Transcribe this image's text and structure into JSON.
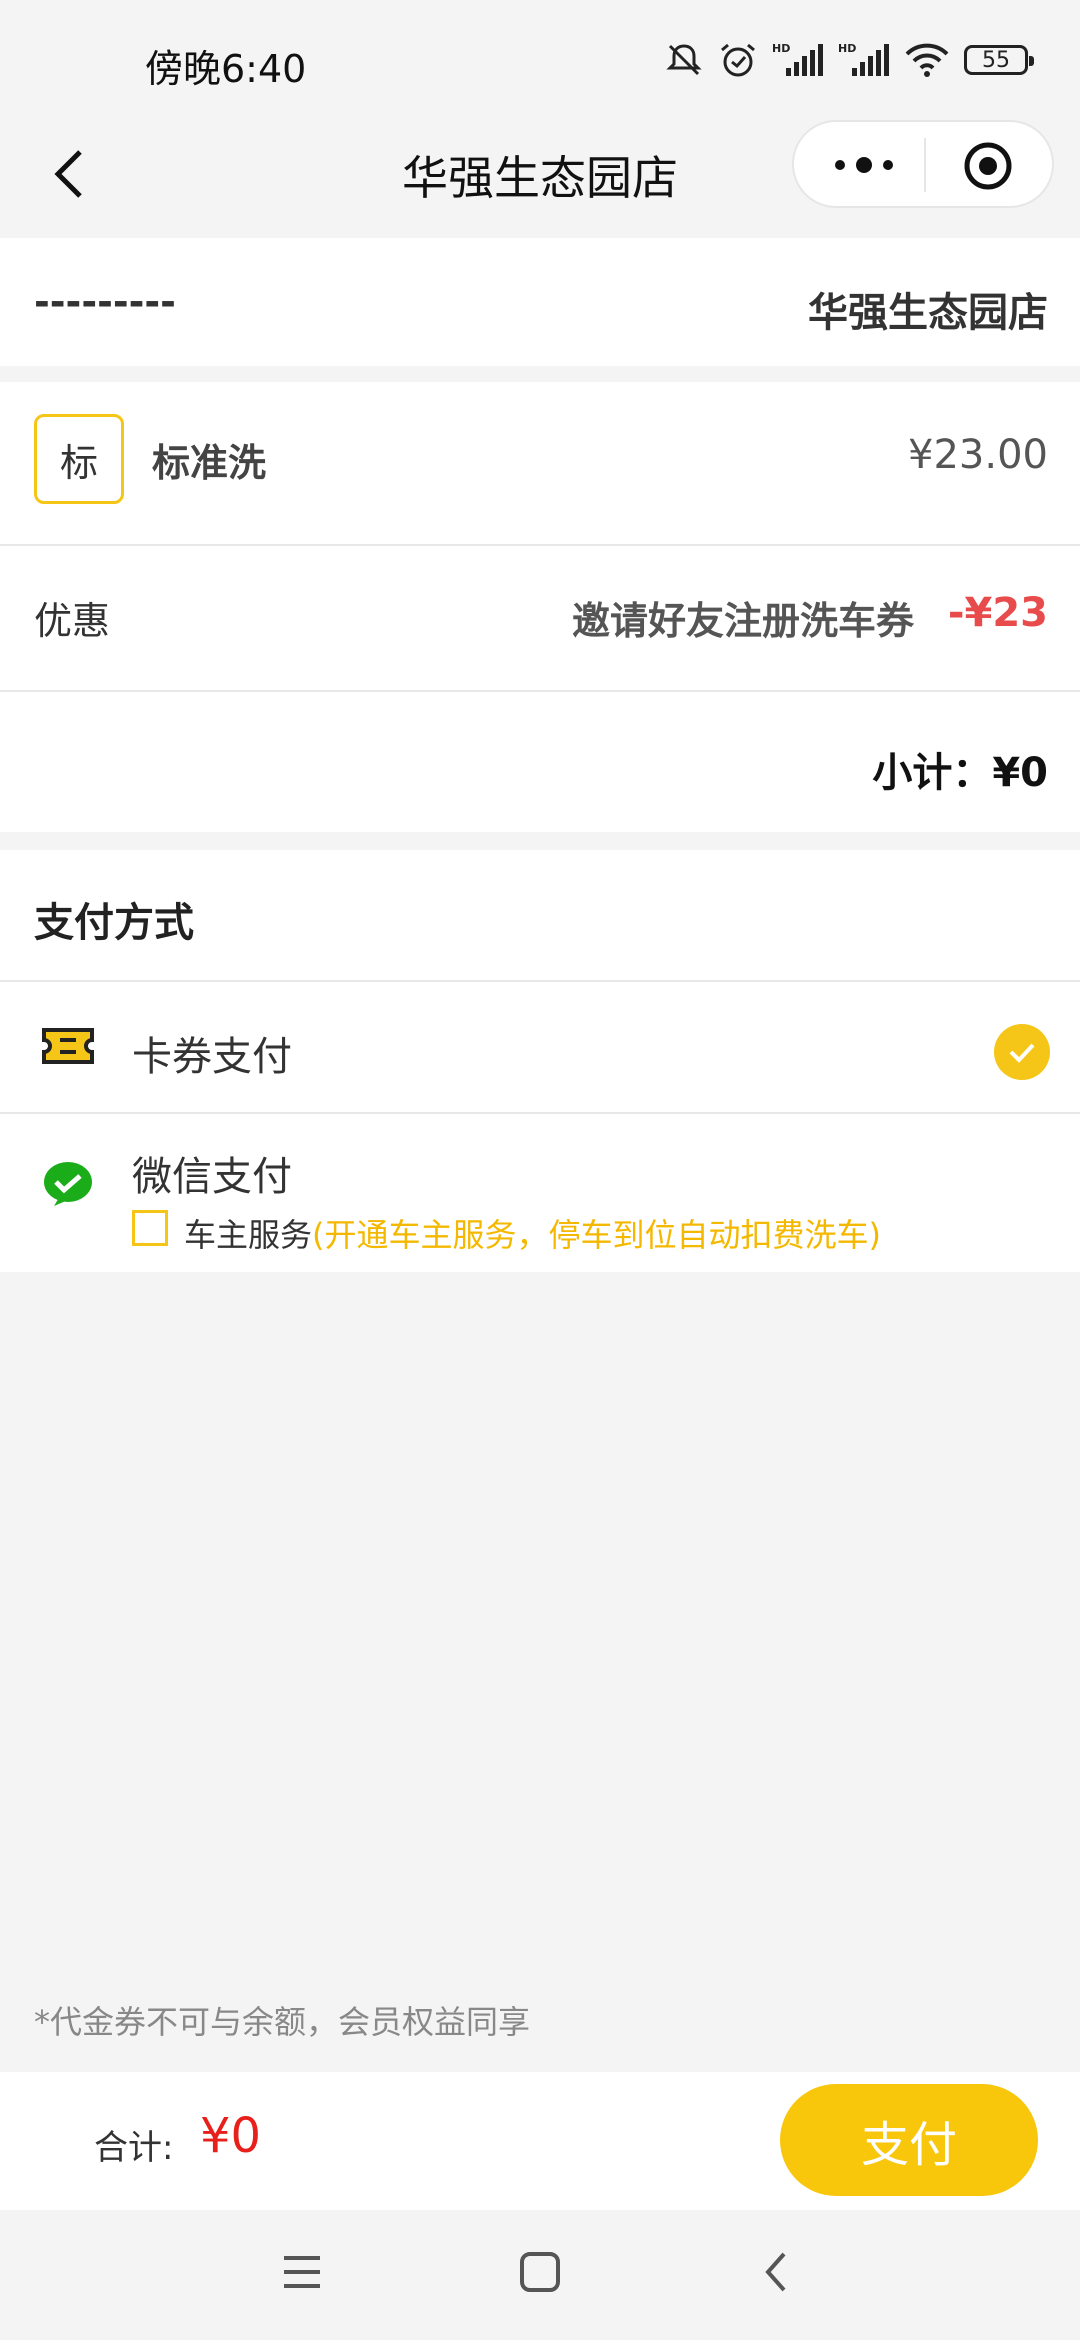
{
  "status_bar": {
    "time": "傍晚6:40",
    "battery": "55"
  },
  "nav": {
    "title": "华强生态园店"
  },
  "store_row": {
    "left": "---------",
    "right": "华强生态园店"
  },
  "service": {
    "tag": "标",
    "name": "标准洗",
    "price": "¥23.00"
  },
  "discount": {
    "label": "优惠",
    "name": "邀请好友注册洗车券",
    "amount": "-¥23"
  },
  "subtotal": {
    "text": "小计：¥0"
  },
  "payment": {
    "header": "支付方式",
    "methods": [
      {
        "label": "卡券支付",
        "icon": "ticket-icon",
        "selected": true
      },
      {
        "label": "微信支付",
        "icon": "wechat-icon",
        "selected": false
      }
    ],
    "owner_service": {
      "label": "车主服务",
      "hint": "(开通车主服务，停车到位自动扣费洗车)"
    }
  },
  "note": "*代金券不可与余额，会员权益同享",
  "footer": {
    "total_label": "合计:",
    "total_value": "¥0",
    "pay_button": "支付"
  },
  "colors": {
    "accent": "#f5c518",
    "price_red": "#e8201b",
    "discount_red": "#e84b4b",
    "wechat_green": "#1aad19"
  }
}
